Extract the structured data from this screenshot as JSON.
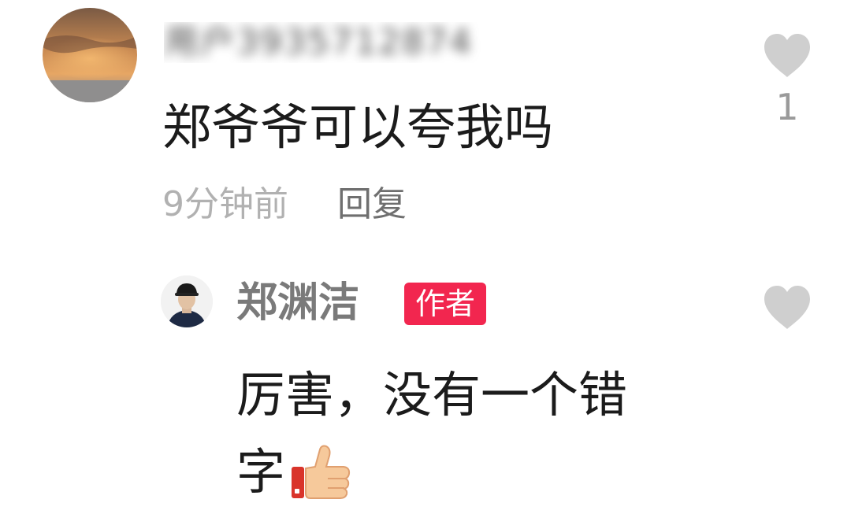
{
  "comment": {
    "username": "用户3935712874",
    "text": "郑爷爷可以夸我吗",
    "time": "9分钟前",
    "reply_label": "回复",
    "like_count": "1",
    "like_icon": "heart-icon"
  },
  "reply": {
    "username": "郑渊洁",
    "badge": "作者",
    "text_line1": "厉害，没有一个错",
    "text_line2": "字",
    "emoji": "thumbs-up-icon",
    "like_icon": "heart-icon"
  },
  "colors": {
    "badge_bg": "#f2264f",
    "heart": "#cfcfcf",
    "meta_text": "#b1b1b1"
  }
}
